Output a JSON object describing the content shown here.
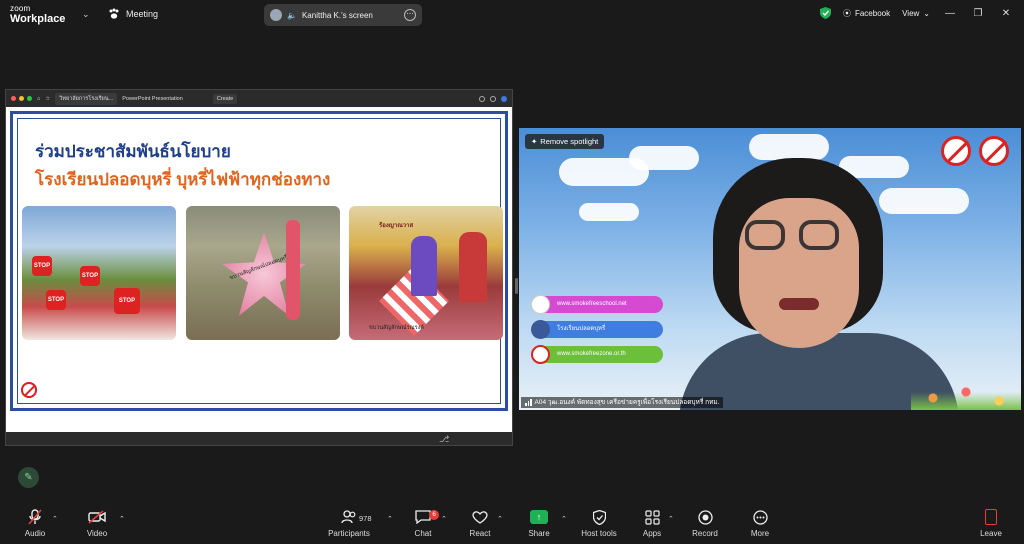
{
  "app": {
    "logo_line1": "zoom",
    "logo_line2": "Workplace",
    "meeting_label": "Meeting"
  },
  "share_indicator": {
    "text": "Kanittha K.'s screen"
  },
  "top_right": {
    "security_icon": "shield-check-icon",
    "facebook_label": "Facebook",
    "view_label": "View"
  },
  "shared_screen": {
    "tab1_title": "วิทยาลัยการโรงเรียน...",
    "tab2_title": "PowerPoint Presentation",
    "tab3_title": "Create",
    "slide_title_line1": "ร่วมประชาสัมพันธ์นโยบาย",
    "slide_title_line2": "โรงเรียนปลอดบุหรี่ บุหรี่ไฟฟ้าทุกช่องทาง",
    "photo2_sign": "ขบวนสัญลักษณ์ปลอดบุหรี่",
    "photo3_banner": "ร้องญาณวาส",
    "photo3_sign": "ขบวนสัญลักษณ์รณรงค์",
    "stop_text": "STOP",
    "colors": {
      "frame_blue": "#2b4ea0",
      "title_blue": "#1f3f8a",
      "title_orange": "#e0641e"
    }
  },
  "video": {
    "remove_spotlight": "Remove spotlight",
    "caption": "A04 วุฒ.อนงค์ พัดทองสุข เครือข่ายครูเพื่อโรงเรียนปลอดบุหรี่ กทม.",
    "links": [
      {
        "text": "www.smokefreeschool.net",
        "color": "#d64ad1"
      },
      {
        "text": "โรงเรียนปลอดบุหรี่",
        "color": "#3f7ee0"
      },
      {
        "text": "www.smokefreezone.or.th",
        "color": "#6bbf3a"
      }
    ]
  },
  "toolbar": {
    "audio": "Audio",
    "video": "Video",
    "participants": "Participants",
    "participants_count": "978",
    "chat": "Chat",
    "chat_badge": "6",
    "react": "React",
    "share": "Share",
    "host_tools": "Host tools",
    "apps": "Apps",
    "record": "Record",
    "more": "More",
    "leave": "Leave"
  }
}
